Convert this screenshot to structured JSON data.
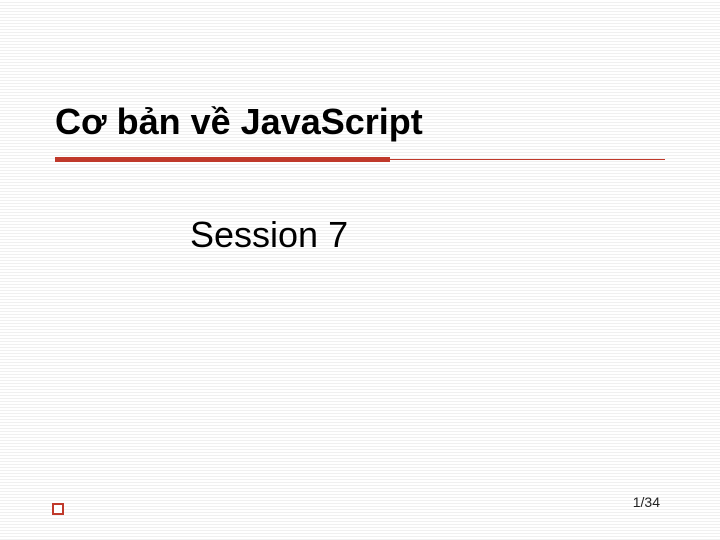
{
  "slide": {
    "title": "Cơ bản về JavaScript",
    "subtitle": "Session 7",
    "page_indicator": "1/34"
  },
  "colors": {
    "accent": "#c0392b"
  }
}
